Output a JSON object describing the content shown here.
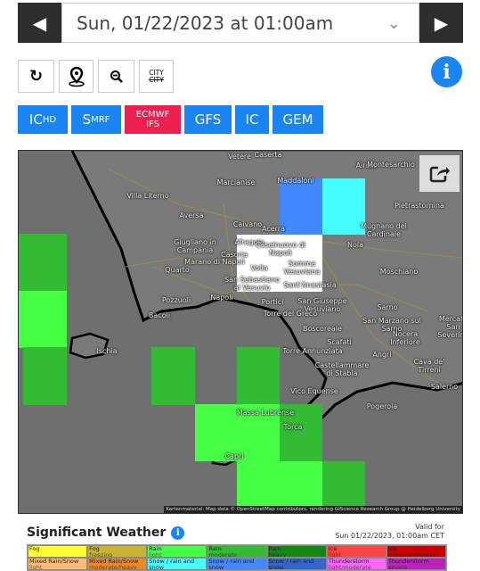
{
  "nav": {
    "prev_icon": "triangle-left-icon",
    "next_icon": "triangle-right-icon",
    "date": "Sun, 01/22/2023 at 01:00am",
    "dropdown_icon": "chevron-down-icon"
  },
  "tools": {
    "refresh_icon": "refresh-icon",
    "location_icon": "map-pin-icon",
    "zoom_out_icon": "zoom-out-icon",
    "city_top": "CITY",
    "city_bottom": "CITY",
    "info_icon": "info-icon"
  },
  "models": [
    {
      "main": "IC",
      "sub": "HD"
    },
    {
      "main": "S",
      "sub": "MRF"
    },
    {
      "line1": "ECMWF",
      "line2": "IFS",
      "active": true
    },
    {
      "main": "GFS"
    },
    {
      "main": "IC"
    },
    {
      "main": "GEM"
    }
  ],
  "colors": {
    "accent": "#1a85f0",
    "active_model": "#ee2050",
    "map_bg": "#6f6f6f"
  },
  "map": {
    "share_icon": "share-icon",
    "attribution": "Kartenmaterial: Map data © OpenStreetMap contributors, rendering GIScience Research Group @ Heidelberg University",
    "places": [
      "Vetere",
      "Caserta",
      "Airola",
      "Montesarchio",
      "Maddaloni",
      "Marcianise",
      "Villa Literno",
      "Pietrastornina",
      "Aversa",
      "Caivano",
      "Acerra",
      "Mugnano del Cardinale",
      "Giugliano in Campania",
      "Afragola",
      "Casalnuovo di Napoli",
      "Nola",
      "Casoria",
      "Marano di Napoli",
      "Quarto",
      "Volla",
      "Somma Vesuviana",
      "Moschiano",
      "San Sebastiano al Vesuvio",
      "Sant'Anastasia",
      "Napoli",
      "Pozzuoli",
      "Portici",
      "San Giuseppe Vesuviano",
      "Sarno",
      "Bacoli",
      "Torre del Greco",
      "San Marzano sul Sarno",
      "Mercato San Severino",
      "Boscoreale",
      "Nocera Inferiore",
      "Scafati",
      "Torre Annunziata",
      "Angri",
      "Ischia",
      "Cava de' Tirreni",
      "Castellammare di Stabia",
      "Vico Equense",
      "Salerno",
      "Pogerola",
      "Massa Lubrense",
      "Torca",
      "Capri"
    ]
  },
  "significant_weather": {
    "title": "Significant Weather",
    "valid_label": "Valid for",
    "valid_time": "Sun 01/22/2023, 01:00am CET",
    "legend": [
      {
        "name": "Fog",
        "sub": "",
        "color": "#ffff33"
      },
      {
        "name": "Fog",
        "sub": "freezing",
        "color": "#c8b432"
      },
      {
        "name": "Rain",
        "sub": "light",
        "color": "#44ff44"
      },
      {
        "name": "Rain",
        "sub": "moderate",
        "color": "#33bb33"
      },
      {
        "name": "Rain",
        "sub": "heavy",
        "color": "#118811"
      },
      {
        "name": "Ice",
        "sub": "light",
        "color": "#ff4444"
      },
      {
        "name": "Ice",
        "sub": "moderate/heavy",
        "color": "#cc0000"
      },
      {
        "name": "Mixed Rain/Snow",
        "sub": "light",
        "color": "#ffbb77"
      },
      {
        "name": "Mixed Rain/Snow",
        "sub": "moderate/heavy",
        "color": "#ee8822"
      },
      {
        "name": "Snow / rain and snow",
        "sub": "light",
        "color": "#44ffff"
      },
      {
        "name": "Snow / rain and snow",
        "sub": "moderate",
        "color": "#4488ff"
      },
      {
        "name": "Snow / rain and snow",
        "sub": "heavy",
        "color": "#3366cc"
      },
      {
        "name": "Thunderstorm",
        "sub": "light/moderate",
        "color": "#ff66ff"
      },
      {
        "name": "Thunderstorm",
        "sub": "severe",
        "color": "#bb22bb"
      }
    ]
  }
}
